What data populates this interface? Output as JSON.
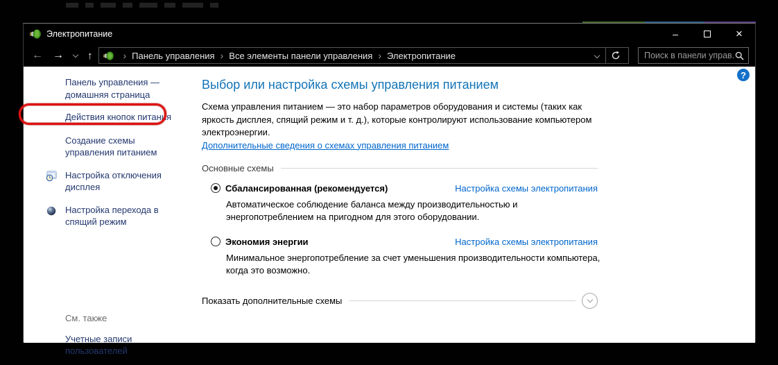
{
  "window": {
    "title": "Электропитание"
  },
  "titlebar_controls": {
    "minimize": "–",
    "maximize_icon": "maximize-square",
    "close": "×"
  },
  "navbar": {
    "back_icon": "←",
    "forward_icon": "→",
    "up_icon": "↑",
    "breadcrumb": [
      "Панель управления",
      "Все элементы панели управления",
      "Электропитание"
    ],
    "separator": "›",
    "search": {
      "placeholder": "Поиск в панели управ...",
      "icon": "magnifier"
    }
  },
  "sidebar": {
    "items": [
      {
        "label": "Панель управления — домашняя страница"
      },
      {
        "label": "Действия кнопок питания",
        "annotated": true
      },
      {
        "label": "Создание схемы управления питанием"
      },
      {
        "label": "Настройка отключения дисплея",
        "icon": "display-clock"
      },
      {
        "label": "Настройка перехода в спящий режим",
        "icon": "sleep-orb"
      }
    ],
    "see_also_label": "См. также",
    "see_also_links": [
      "Учетные записи пользователей"
    ]
  },
  "main": {
    "title": "Выбор или настройка схемы управления питанием",
    "description": "Схема управления питанием — это набор параметров оборудования и системы (таких как яркость дисплея, спящий режим и т. д.), которые контролируют использование компьютером электроэнергии.",
    "more_info_link": "Дополнительные сведения о схемах управления питанием",
    "section_label": "Основные схемы",
    "plans": [
      {
        "name": "Сбалансированная (рекомендуется)",
        "selected": true,
        "settings_link": "Настройка схемы электропитания",
        "description": "Автоматическое соблюдение баланса между производительностью и энергопотреблением на пригодном для этого оборудовании."
      },
      {
        "name": "Экономия энергии",
        "selected": false,
        "settings_link": "Настройка схемы электропитания",
        "description": "Минимальное энергопотребление за счет уменьшения производительности компьютера, когда это возможно."
      }
    ],
    "show_additional_label": "Показать дополнительные схемы",
    "expander_icon": "chevron-down"
  },
  "help_icon": "?",
  "colors": {
    "titlebar_bg": "#000000",
    "content_bg": "#ffffff",
    "heading": "#1274b8",
    "content_link": "#0066cc",
    "sidebar_link": "#24386f",
    "annotation_red": "#de1212",
    "help_blue": "#1470c8"
  }
}
